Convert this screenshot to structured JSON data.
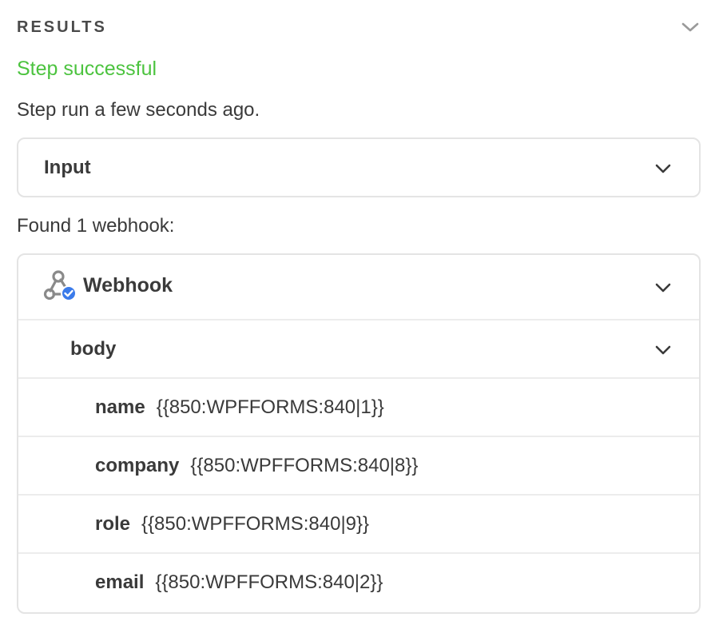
{
  "section": {
    "title": "RESULTS",
    "collapse_icon": "chevron-down-icon"
  },
  "status": {
    "text": "Step successful",
    "color": "#4cc33f"
  },
  "run_time": "Step run a few seconds ago.",
  "input_card": {
    "label": "Input"
  },
  "found_text": "Found 1 webhook:",
  "webhook": {
    "title": "Webhook",
    "icon": "webhook-verified-icon",
    "badge_color": "#3b7bea",
    "body": {
      "label": "body",
      "fields": [
        {
          "key": "name",
          "value": "{{850:WPFFORMS:840|1}}"
        },
        {
          "key": "company",
          "value": "{{850:WPFFORMS:840|8}}"
        },
        {
          "key": "role",
          "value": "{{850:WPFFORMS:840|9}}"
        },
        {
          "key": "email",
          "value": "{{850:WPFFORMS:840|2}}"
        }
      ]
    }
  }
}
